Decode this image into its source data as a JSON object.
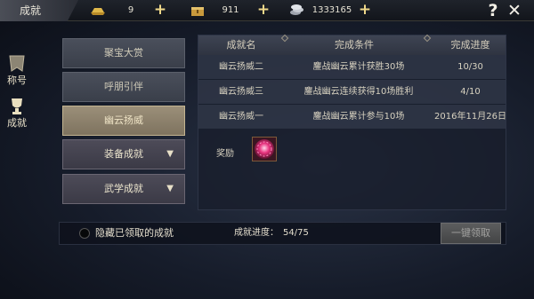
{
  "window": {
    "title": "成就"
  },
  "resources": [
    {
      "icon": "gold-ingot-icon",
      "value": "9"
    },
    {
      "icon": "treasure-chest-icon",
      "value": "911"
    },
    {
      "icon": "silver-coins-icon",
      "value": "1333165"
    }
  ],
  "top_actions": {
    "help": "?",
    "close": "✕"
  },
  "side_tabs": [
    {
      "label": "称号",
      "icon": "title-banner-icon"
    },
    {
      "label": "成就",
      "icon": "trophy-icon"
    }
  ],
  "menu": {
    "items": [
      {
        "label": "聚宝大赏"
      },
      {
        "label": "呼朋引伴"
      },
      {
        "label": "幽云扬威",
        "active": true
      }
    ],
    "groups": [
      {
        "label": "装备成就"
      },
      {
        "label": "武学成就"
      }
    ]
  },
  "table": {
    "headers": [
      "成就名",
      "完成条件",
      "完成进度"
    ],
    "rows": [
      {
        "name": "幽云扬威二",
        "condition": "鏖战幽云累计获胜30场",
        "progress": "10/30"
      },
      {
        "name": "幽云扬威三",
        "condition": "鏖战幽云连续获得10场胜利",
        "progress": "4/10"
      },
      {
        "name": "幽云扬威一",
        "condition": "鏖战幽云累计参与10场",
        "progress": "2016年11月26日"
      }
    ]
  },
  "reward": {
    "label": "奖励",
    "icon": "pink-gem-orb-icon"
  },
  "footer": {
    "hide_claimed_label": "隐藏已领取的成就",
    "progress_label": "成就进度：",
    "progress_value": "54/75",
    "claim_all_label": "一键领取"
  },
  "colors": {
    "active_tab": "#9b8f79",
    "accent_gold": "#f0d98a",
    "disabled_button": "#5c5d5e"
  }
}
